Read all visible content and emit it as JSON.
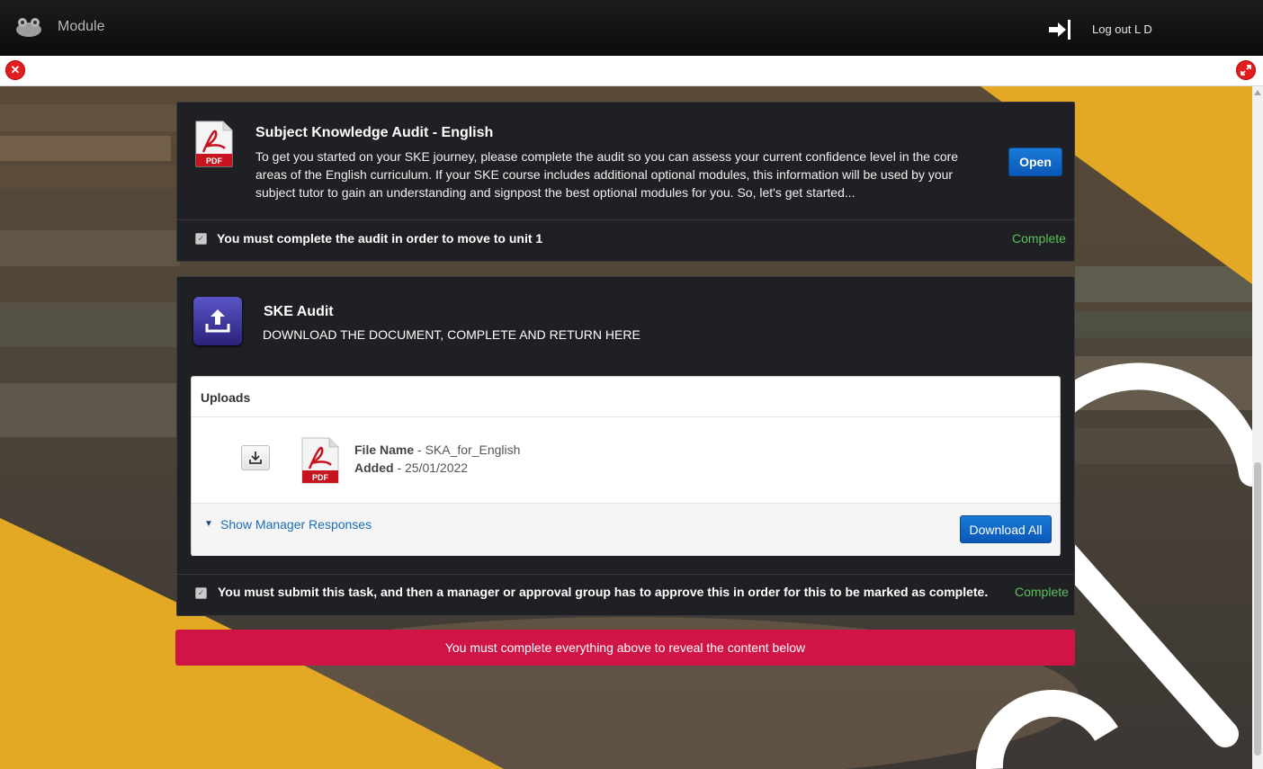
{
  "app": {
    "module_label": "Module",
    "logout_label": "Log out L D"
  },
  "toolbar": {
    "close_icon": "close-icon",
    "expand_icon": "expand-icon"
  },
  "audit_panel": {
    "title": "Subject Knowledge Audit - English",
    "description": "To get you started on your SKE journey, please complete the audit so you can assess your current confidence level in the core areas of the English curriculum. If your SKE course includes additional optional modules, this information will be used by your subject tutor to gain an understanding and signpost the best optional modules for you. So, let's get started...",
    "open_label": "Open",
    "requirement": "You must complete the audit in order to move to unit 1",
    "status": "Complete",
    "pdf_label": "PDF"
  },
  "ske_panel": {
    "title": "SKE Audit",
    "subtitle": "DOWNLOAD THE DOCUMENT, COMPLETE AND RETURN HERE",
    "uploads": {
      "heading": "Uploads",
      "file_name_label": "File Name",
      "file_name_value": " - SKA_for_English",
      "added_label": "Added",
      "added_value": " - 25/01/2022",
      "pdf_label": "PDF",
      "show_responses": "Show Manager Responses",
      "download_all": "Download All"
    },
    "requirement": "You must submit this task, and then a manager or approval group has to approve this in order for this to be marked as complete.",
    "status": "Complete"
  },
  "alert": {
    "text": "You must complete everything above to reveal the content below"
  },
  "colors": {
    "accent_blue": "#0a58b8",
    "alert_red": "#d11446",
    "complete_green": "#5cc15c",
    "panel_bg": "#1f2023",
    "yellow_shape": "#e3a924"
  }
}
